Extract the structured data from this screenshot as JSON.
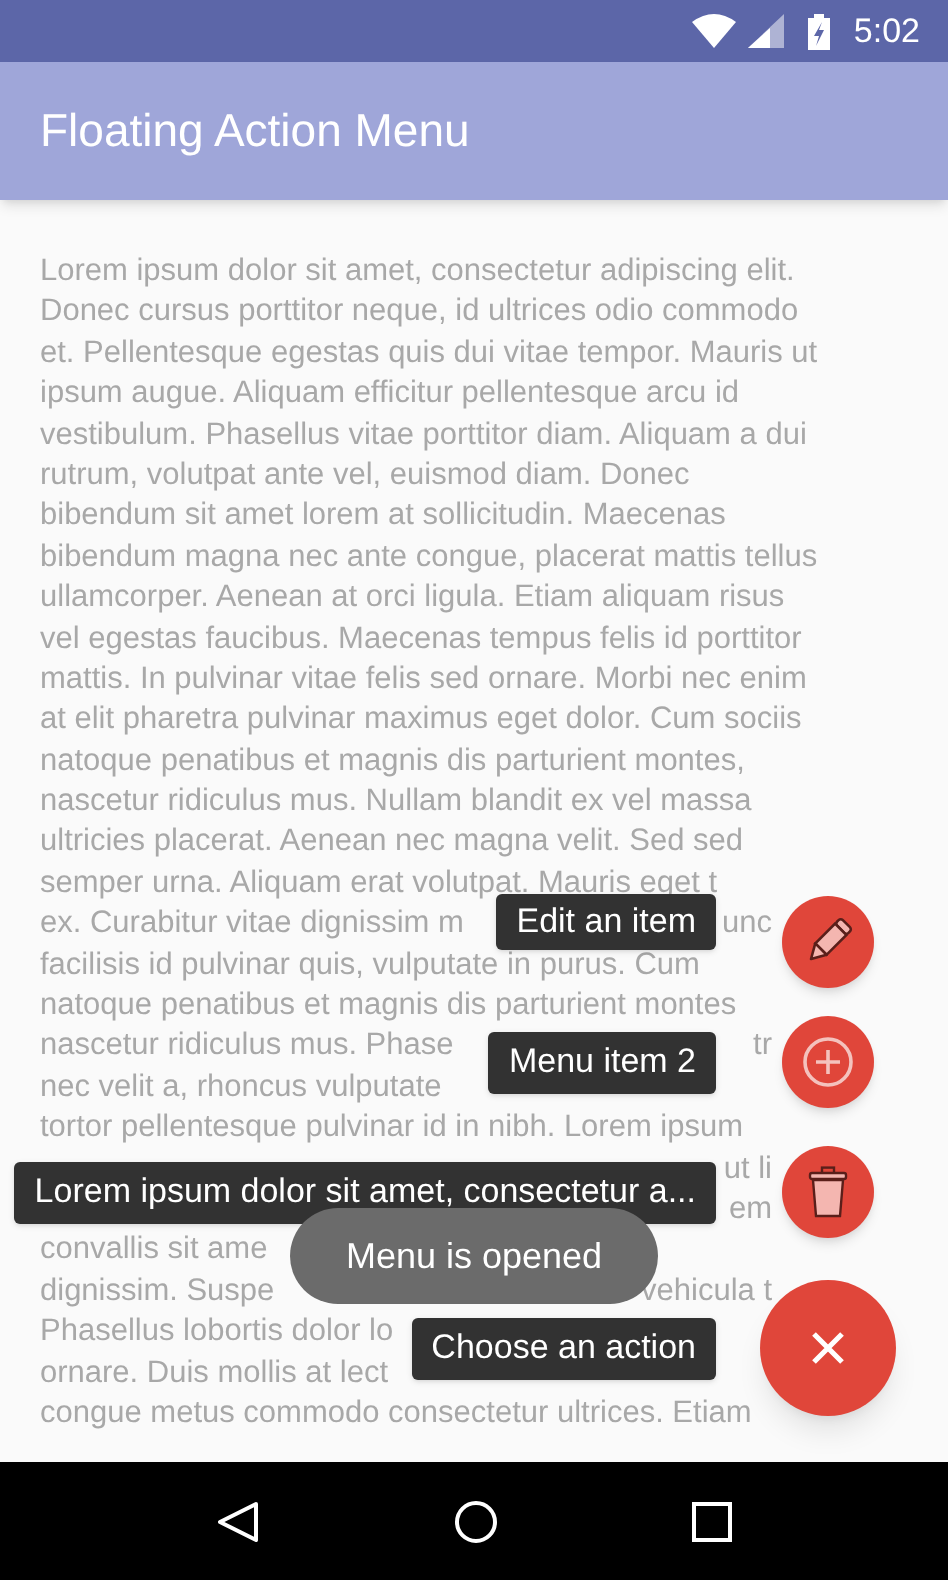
{
  "status_bar": {
    "time": "5:02"
  },
  "app_bar": {
    "title": "Floating Action Menu"
  },
  "body_lines": [
    {
      "text": "Lorem ipsum dolor sit amet, consectetur adipiscing elit."
    },
    {
      "text": "Donec cursus porttitor neque, id ultrices odio commodo"
    },
    {
      "text": "et. Pellentesque egestas quis dui vitae tempor. Mauris ut"
    },
    {
      "text": "ipsum augue. Aliquam efficitur pellentesque arcu id"
    },
    {
      "text": "vestibulum. Phasellus vitae porttitor diam. Aliquam a dui"
    },
    {
      "text": "rutrum, volutpat ante vel, euismod diam. Donec"
    },
    {
      "text": "bibendum sit amet lorem at sollicitudin. Maecenas"
    },
    {
      "text": "bibendum magna nec ante congue, placerat mattis tellus"
    },
    {
      "text": "ullamcorper. Aenean at orci ligula. Etiam aliquam risus"
    },
    {
      "text": "vel egestas faucibus. Maecenas tempus felis id porttitor"
    },
    {
      "text": "mattis. In pulvinar vitae felis sed ornare. Morbi nec enim"
    },
    {
      "text": "at elit pharetra pulvinar maximus eget dolor. Cum sociis"
    },
    {
      "text": "natoque penatibus et magnis dis parturient montes,"
    },
    {
      "text": "nascetur ridiculus mus. Nullam blandit ex vel massa"
    },
    {
      "text": "ultricies placerat. Aenean nec magna velit. Sed sed"
    },
    {
      "text": "semper urna. Aliquam erat volutpat. Mauris eget t"
    },
    {
      "text": "ex. Curabitur vitae dignissim m",
      "tail": "unc"
    },
    {
      "text": "facilisis id pulvinar quis, vulputate in purus. Cum"
    },
    {
      "text": "natoque penatibus et magnis dis parturient montes"
    },
    {
      "text": "nascetur ridiculus mus. Phase",
      "tail": "tr"
    },
    {
      "text": "nec velit a, rhoncus vulputate"
    },
    {
      "text": "tortor pellentesque pulvinar id in nibh. Lorem ipsum"
    },
    {
      "tail": "ut li"
    },
    {
      "tail": "em"
    },
    {
      "text": "convallis sit ame"
    },
    {
      "text": "dignissim. Suspe",
      "tail": "vehicula t"
    },
    {
      "text": "Phasellus lobortis dolor lo"
    },
    {
      "text": "ornare. Duis mollis at lect"
    },
    {
      "text": "congue metus commodo consectetur ultrices. Etiam"
    }
  ],
  "menu_items": [
    {
      "label": "Edit an item",
      "kind": "edit"
    },
    {
      "label": "Menu item 2",
      "kind": "add"
    },
    {
      "label": "Lorem ipsum dolor sit amet, consectetur a...",
      "kind": "delete"
    }
  ],
  "main_button": {
    "label": "Choose an action",
    "kind": "close"
  },
  "toast": "Menu is opened"
}
